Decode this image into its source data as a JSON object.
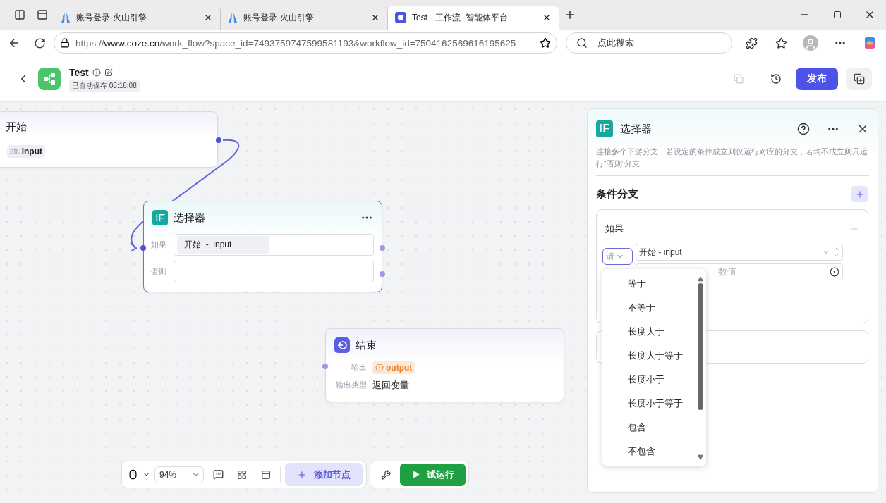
{
  "browser": {
    "tabs": [
      {
        "title": "账号登录-火山引擎",
        "selected": false
      },
      {
        "title": "账号登录-火山引擎",
        "selected": false
      },
      {
        "title": "Test - 工作流 -智能体平台",
        "selected": true
      }
    ],
    "url": {
      "scheme": "https://",
      "host": "www.coze.cn",
      "path": "/work_flow?space_id=7493759747599581193&workflow_id=7504162569616195625"
    },
    "search_placeholder": "点此搜索"
  },
  "header": {
    "title": "Test",
    "autosave": "已自动保存 08:16:08",
    "publish": "发布"
  },
  "nodes": [
    {
      "kind": "start",
      "title": "开始",
      "type_tag": "str.",
      "param": "input"
    },
    {
      "kind": "condition",
      "title": "选择器",
      "badge": "IF",
      "rows": [
        {
          "label": "如果",
          "chip": "开始  -  input"
        },
        {
          "label": "否则"
        }
      ]
    },
    {
      "kind": "end",
      "title": "结束",
      "rows": [
        {
          "label": "输出",
          "tag": "output"
        },
        {
          "label": "输出类型",
          "value": "返回变量"
        }
      ]
    }
  ],
  "panel": {
    "badge": "IF",
    "title": "选择器",
    "description": "连接多个下游分支，若设定的条件成立则仅运行对应的分支，若均不成立则只运行“否则”分支",
    "section_title": "条件分支",
    "branch": {
      "title": "如果",
      "operator": "请",
      "left": "开始 - input",
      "right_placeholder": "数值"
    }
  },
  "dropdown": {
    "options": [
      "等于",
      "不等于",
      "长度大于",
      "长度大于等于",
      "长度小于",
      "长度小于等于",
      "包含",
      "不包含"
    ]
  },
  "toolbar": {
    "zoom": "94%",
    "add_node": "添加节点",
    "run": "试运行"
  }
}
